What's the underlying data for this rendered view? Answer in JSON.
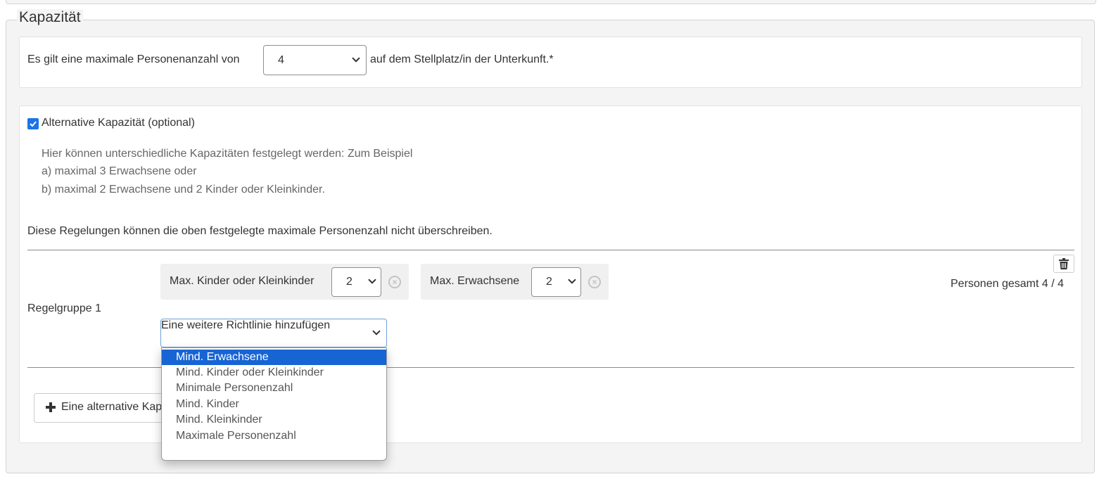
{
  "capacity": {
    "legend": "Kapazität",
    "max_prefix": "Es gilt eine maximale Personenanzahl von",
    "max_value": "4",
    "max_suffix": "auf dem Stellplatz/in der Unterkunft.*"
  },
  "alternative": {
    "checked": true,
    "checkbox_label": "Alternative Kapazität (optional)",
    "hint_lines": [
      "Hier können unterschiedliche Kapazitäten festgelegt werden: Zum Beispiel",
      "a) maximal 3 Erwachsene oder",
      "b) maximal 2 Erwachsene und 2 Kinder oder Kleinkinder."
    ],
    "note": "Diese Regelungen können die oben festgelegte maximale Personenzahl nicht überschreiben."
  },
  "rule_group": {
    "label": "Regelgruppe 1",
    "rules": [
      {
        "label": "Max. Kinder oder Kleinkinder",
        "value": "2"
      },
      {
        "label": "Max. Erwachsene",
        "value": "2"
      }
    ],
    "total_text": "Personen gesamt 4 / 4",
    "add_rule_placeholder": "Eine weitere Richtlinie hinzufügen",
    "options": [
      "Mind. Erwachsene",
      "Mind. Kinder oder Kleinkinder",
      "Minimale Personenzahl",
      "Mind. Kinder",
      "Mind. Kleinkinder",
      "Maximale Personenzahl"
    ],
    "selected_option_index": 0
  },
  "add_alternative_label": "Eine alternative Kapazität hinzufügen",
  "icons": {
    "trash": "trash-icon",
    "plus": "plus-icon",
    "clear": "clear-circle-icon",
    "chevron": "chevron-down-icon"
  },
  "colors": {
    "accent": "#1764d4",
    "checkbox": "#1a73e8",
    "focus_border": "#6da0d8"
  }
}
